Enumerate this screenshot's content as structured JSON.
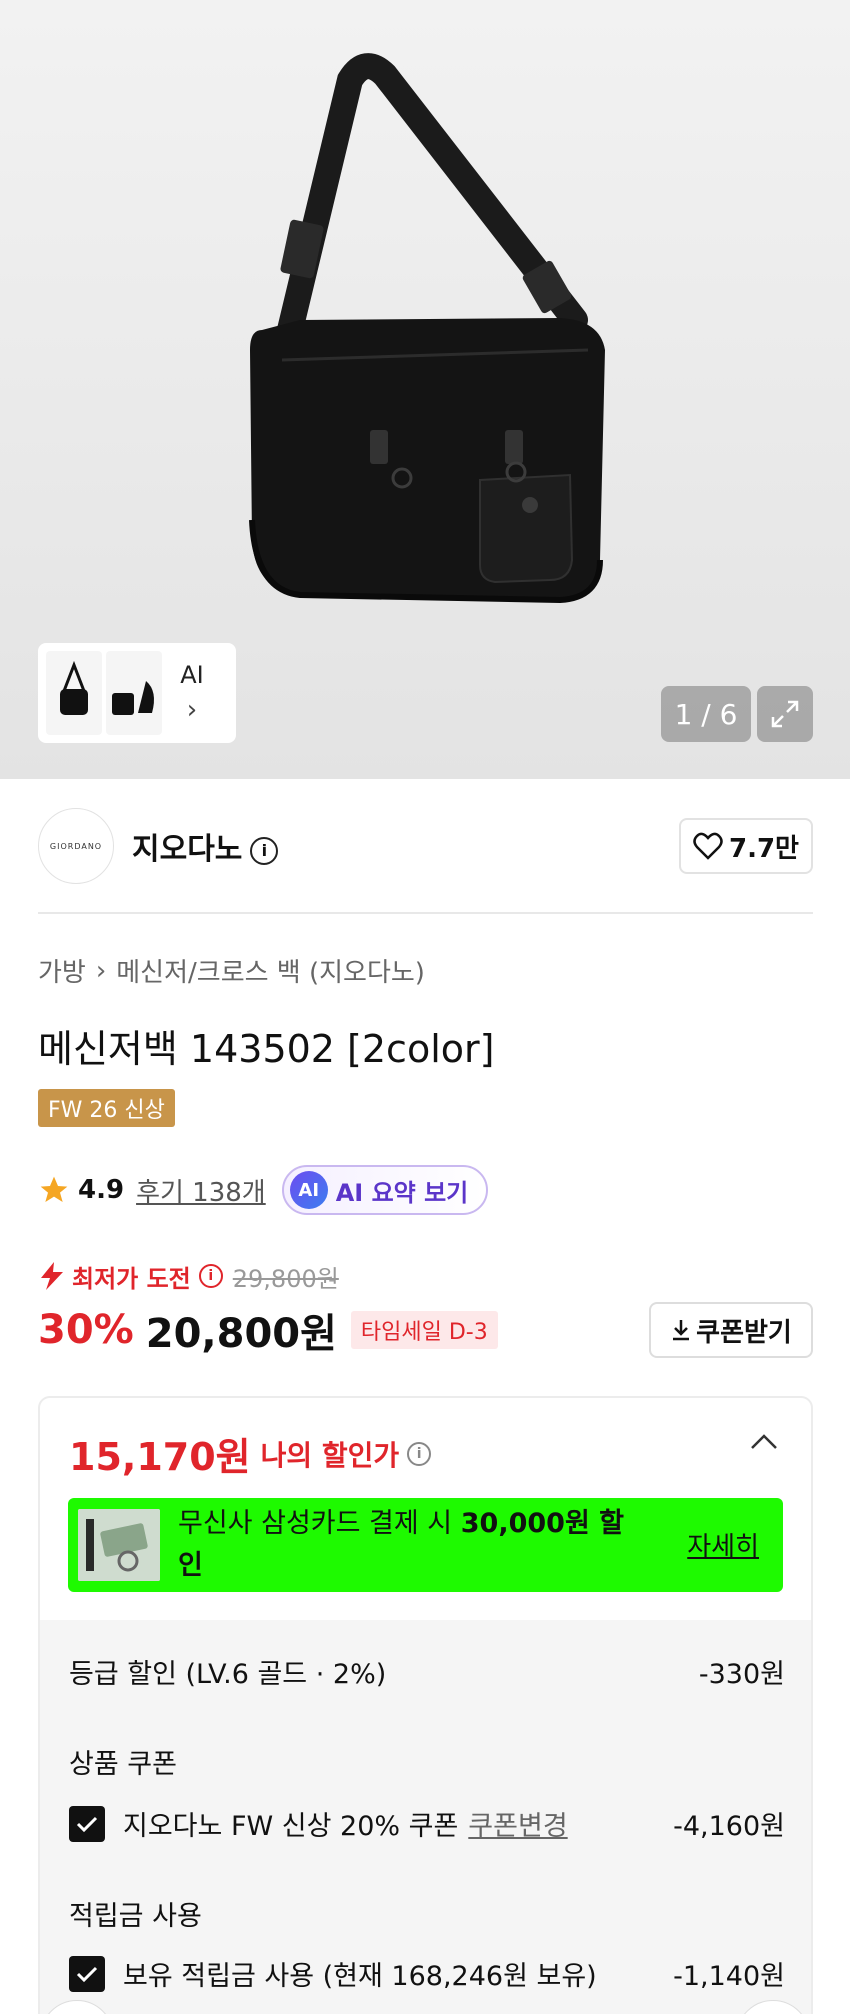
{
  "gallery": {
    "thumbnail_ai_label": "AI",
    "page_indicator": "1 / 6"
  },
  "brand": {
    "logo_text": "GIORDANO",
    "name": "지오다노",
    "like_count": "7.7만"
  },
  "breadcrumb": {
    "category": "가방",
    "subcategory": "메신저/크로스 백 (지오다노)"
  },
  "product": {
    "title": "메신저백 143502 [2color]",
    "season_tag": "FW 26 신상"
  },
  "rating": {
    "score": "4.9",
    "reviews": "후기 138개",
    "ai_badge": "AI",
    "ai_summary_label": "AI 요약 보기"
  },
  "price": {
    "lowest_label": "최저가 도전",
    "original": "29,800원",
    "discount_pct": "30%",
    "sale_price": "20,800원",
    "timesale": "타임세일 D-3",
    "coupon_button": "쿠폰받기"
  },
  "my_discount": {
    "amount": "15,170원",
    "label": "나의 할인가",
    "card_banner_text": "무신사 삼성카드 결제 시",
    "card_banner_amount": "30,000원 할인",
    "card_banner_detail": "자세히"
  },
  "breakdown": {
    "grade_label": "등급 할인 (LV.6 골드 · 2%)",
    "grade_value": "-330원",
    "coupon_heading": "상품 쿠폰",
    "coupon_label": "지오다노 FW 신상 20% 쿠폰",
    "coupon_change": "쿠폰변경",
    "coupon_value": "-4,160원",
    "points_heading": "적립금 사용",
    "points_label": "보유 적립금 사용 (현재 168,246원 보유)",
    "points_value": "-1,140원"
  },
  "colors": {
    "accent_red": "#e0252b",
    "banner_green": "#1efa00",
    "season_tag": "#c8954a",
    "ai_purple": "#5b35c9"
  }
}
